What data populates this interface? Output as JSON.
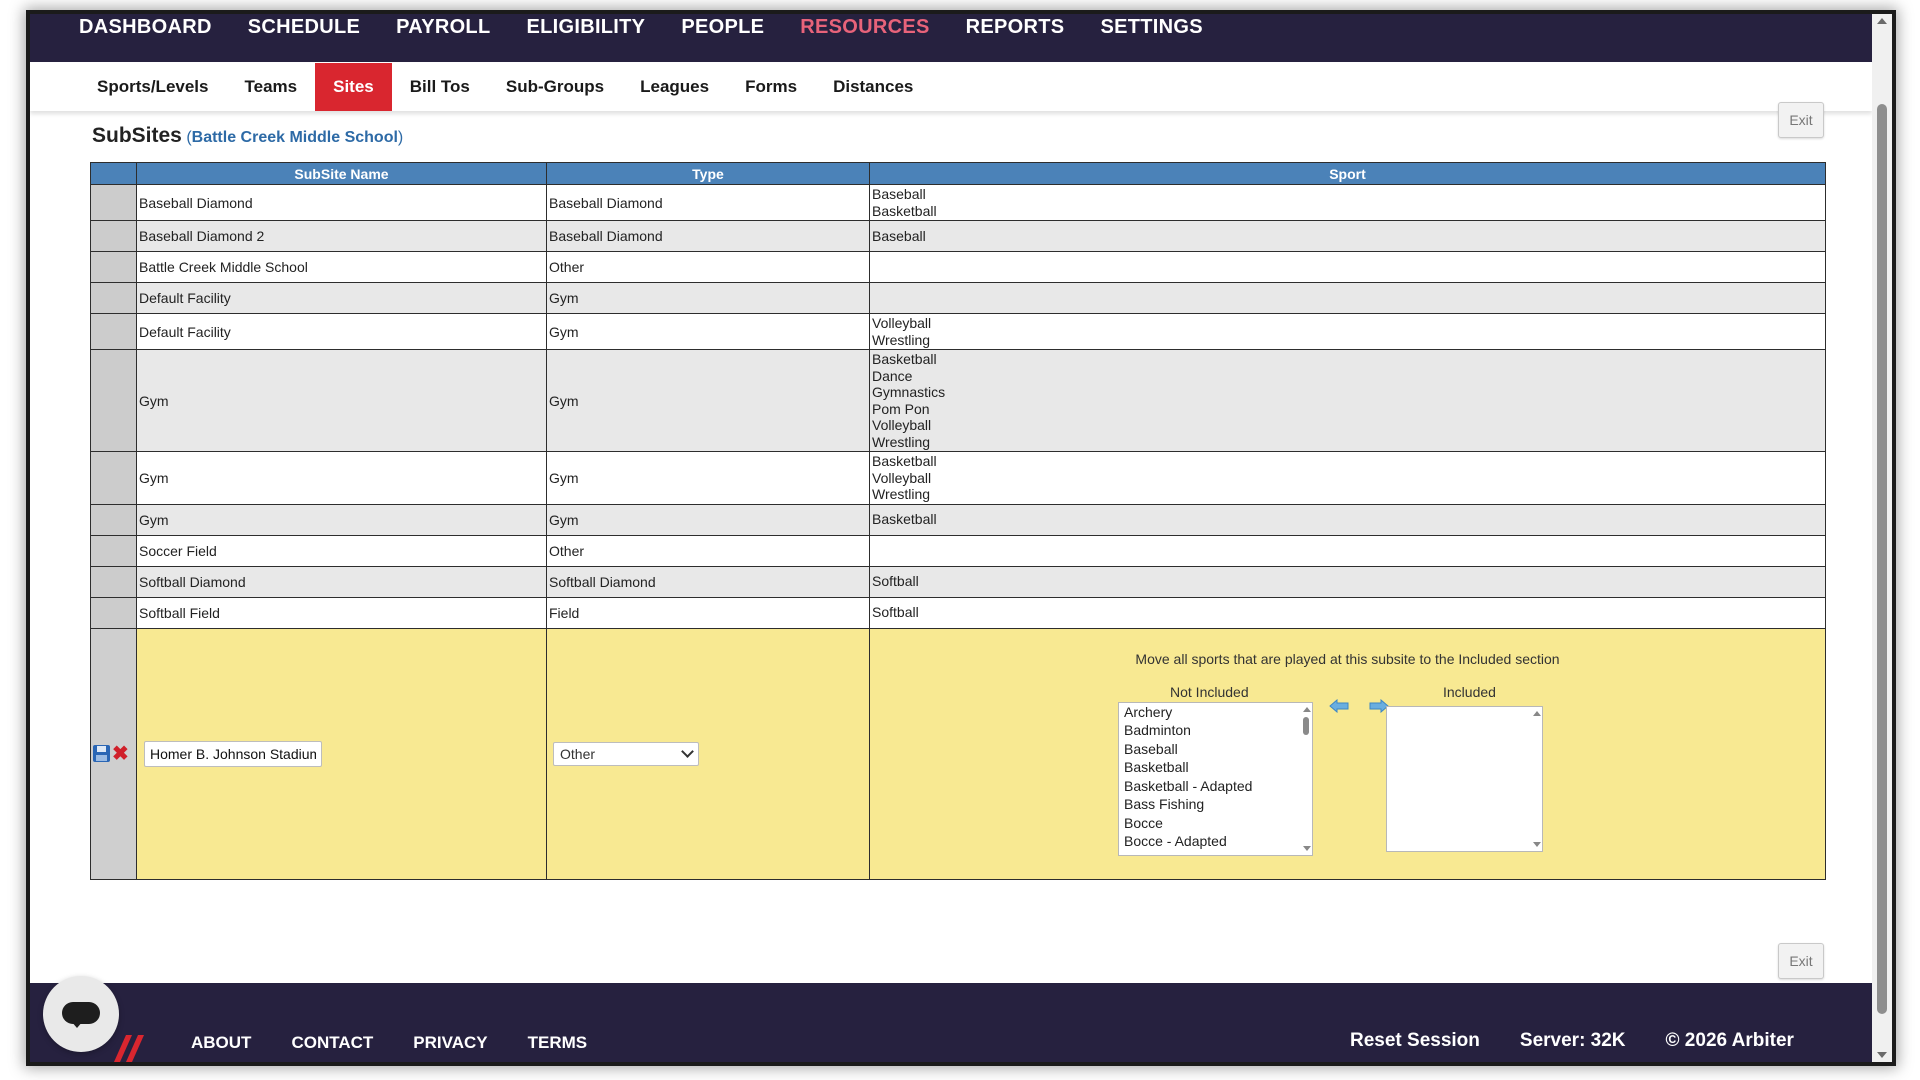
{
  "top_nav": [
    {
      "label": "DASHBOARD",
      "active": false
    },
    {
      "label": "SCHEDULE",
      "active": false
    },
    {
      "label": "PAYROLL",
      "active": false
    },
    {
      "label": "ELIGIBILITY",
      "active": false
    },
    {
      "label": "PEOPLE",
      "active": false
    },
    {
      "label": "RESOURCES",
      "active": true
    },
    {
      "label": "REPORTS",
      "active": false
    },
    {
      "label": "SETTINGS",
      "active": false
    }
  ],
  "sub_nav": [
    {
      "label": "Sports/Levels",
      "active": false
    },
    {
      "label": "Teams",
      "active": false
    },
    {
      "label": "Sites",
      "active": true
    },
    {
      "label": "Bill Tos",
      "active": false
    },
    {
      "label": "Sub-Groups",
      "active": false
    },
    {
      "label": "Leagues",
      "active": false
    },
    {
      "label": "Forms",
      "active": false
    },
    {
      "label": "Distances",
      "active": false
    }
  ],
  "page": {
    "title": "SubSites",
    "parent_open": "(",
    "parent_name": "Battle Creek Middle School",
    "parent_close": ")",
    "exit_label": "Exit"
  },
  "table": {
    "headers": [
      "SubSite Name",
      "Type",
      "Sport"
    ],
    "rows": [
      {
        "name": "Baseball Diamond",
        "type": "Baseball Diamond",
        "sports": [
          "Baseball",
          "Basketball"
        ]
      },
      {
        "name": "Baseball Diamond 2",
        "type": "Baseball Diamond",
        "sports": [
          "Baseball"
        ]
      },
      {
        "name": "Battle Creek Middle School",
        "type": "Other",
        "sports": []
      },
      {
        "name": "Default Facility",
        "type": "Gym",
        "sports": []
      },
      {
        "name": "Default Facility",
        "type": "Gym",
        "sports": [
          "Volleyball",
          "Wrestling"
        ]
      },
      {
        "name": "Gym",
        "type": "Gym",
        "sports": [
          "Basketball",
          "Dance",
          "Gymnastics",
          "Pom Pon",
          "Volleyball",
          "Wrestling"
        ]
      },
      {
        "name": "Gym",
        "type": "Gym",
        "sports": [
          "Basketball",
          "Volleyball",
          "Wrestling"
        ]
      },
      {
        "name": "Gym",
        "type": "Gym",
        "sports": [
          "Basketball"
        ]
      },
      {
        "name": "Soccer Field",
        "type": "Other",
        "sports": []
      },
      {
        "name": "Softball Diamond",
        "type": "Softball Diamond",
        "sports": [
          "Softball"
        ]
      },
      {
        "name": "Softball Field",
        "type": "Field",
        "sports": [
          "Softball"
        ]
      }
    ]
  },
  "edit_row": {
    "name_value": "Homer B. Johnson Stadium",
    "type_value": "Other",
    "instructions": "Move all sports that are played at this subsite to the Included section",
    "not_included_label": "Not Included",
    "included_label": "Included",
    "not_included": [
      "Archery",
      "Badminton",
      "Baseball",
      "Basketball",
      "Basketball - Adapted",
      "Bass Fishing",
      "Bocce",
      "Bocce - Adapted"
    ],
    "included": []
  },
  "footer": {
    "links": [
      "ABOUT",
      "CONTACT",
      "PRIVACY",
      "TERMS"
    ],
    "reset": "Reset Session",
    "server": "Server: 32K",
    "copyright": "© 2026 Arbiter"
  },
  "colors": {
    "nav_bg": "#26213f",
    "active_nav": "#e8637a",
    "active_tab": "#d9262f",
    "table_header": "#4b82b8",
    "edit_row": "#f8e992"
  }
}
